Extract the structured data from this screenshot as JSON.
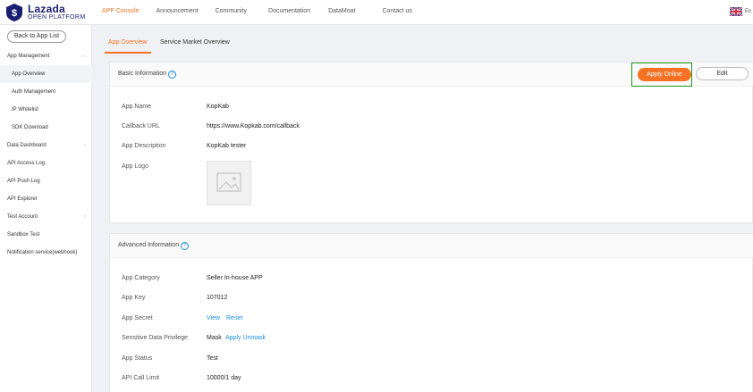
{
  "brand": {
    "name": "Lazada",
    "subtitle": "OPEN PLATFORM",
    "color": "#1a1f71",
    "accent": "#f57224"
  },
  "topnav": [
    "APP Console",
    "Announcement",
    "Community",
    "Documentation",
    "DataMoat",
    "Contact us"
  ],
  "lang": "En",
  "sidebar": {
    "back_label": "Back to App List",
    "items": [
      {
        "label": "App Management"
      },
      {
        "label": "App Overview"
      },
      {
        "label": "Auth Management"
      },
      {
        "label": "IP Whitelist"
      },
      {
        "label": "SDK Download"
      },
      {
        "label": "Data Dashboard"
      },
      {
        "label": "API Access Log"
      },
      {
        "label": "API Push Log"
      },
      {
        "label": "API Explorer"
      },
      {
        "label": "Test Account"
      },
      {
        "label": "Sandbox Test"
      },
      {
        "label": "Notification service(webhook)"
      }
    ]
  },
  "tabs": [
    "App Overview",
    "Service Market Overview"
  ],
  "basic": {
    "title": "Basic Information",
    "apply_label": "Apply Online",
    "edit_label": "Edit",
    "rows": [
      {
        "label": "App Name",
        "value": "KopKab"
      },
      {
        "label": "Callback URL",
        "value": "https://www.Kopkab.com/callback"
      },
      {
        "label": "App Description",
        "value": "KopKab tester"
      },
      {
        "label": "App Logo",
        "value": ""
      }
    ]
  },
  "advanced": {
    "title": "Advanced Information",
    "rows": [
      {
        "label": "App Category",
        "value": "Seller In-house APP"
      },
      {
        "label": "App Key",
        "value": "107012"
      },
      {
        "label": "App Secret",
        "view": "View",
        "reset": "Reset"
      },
      {
        "label": "Sensitive Data Privilege",
        "value": "Mask",
        "action": "Apply Unmask"
      },
      {
        "label": "App Status",
        "value": "Test"
      },
      {
        "label": "API Call Limit",
        "value": "10000/1 day"
      }
    ]
  }
}
